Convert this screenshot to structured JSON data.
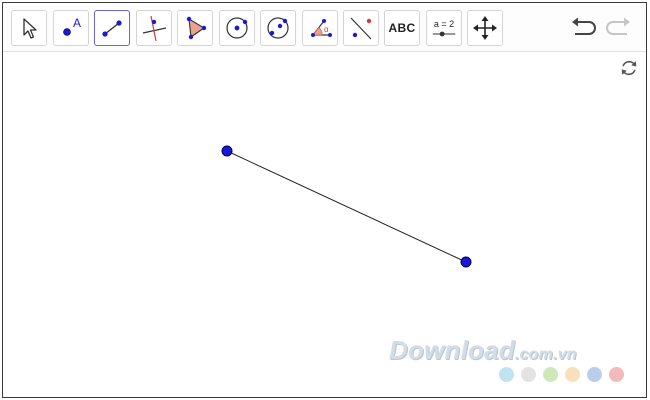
{
  "toolbar": {
    "tools": [
      {
        "name": "Move",
        "icon": "arrow-cursor-icon"
      },
      {
        "name": "Point",
        "icon": "point-icon",
        "label": "A"
      },
      {
        "name": "Segment",
        "icon": "segment-icon",
        "active": true
      },
      {
        "name": "Perpendicular Line",
        "icon": "perpendicular-line-icon"
      },
      {
        "name": "Polygon",
        "icon": "polygon-icon"
      },
      {
        "name": "Circle with Center through Point",
        "icon": "circle-center-point-icon"
      },
      {
        "name": "Circle through 3 Points",
        "icon": "circle-three-points-icon"
      },
      {
        "name": "Angle",
        "icon": "angle-icon",
        "label": "α"
      },
      {
        "name": "Reflect about Line",
        "icon": "reflect-line-icon"
      },
      {
        "name": "Text",
        "icon": "text-icon",
        "label": "ABC"
      },
      {
        "name": "Slider",
        "icon": "slider-icon",
        "label": "a = 2"
      },
      {
        "name": "Move Graphics View",
        "icon": "move-graphics-icon"
      }
    ],
    "undo_icon": "undo-icon",
    "redo_icon": "redo-icon"
  },
  "canvas": {
    "refresh_icon": "refresh-icon",
    "segment": {
      "color": "#222222"
    },
    "point_color": "#1a1ad6"
  },
  "watermark": {
    "text_main": "Download",
    "text_domain": ".com.vn",
    "dot_colors": [
      "#bfe3f1",
      "#e3e3e3",
      "#cde9b9",
      "#f9e0b9",
      "#b7cfe9",
      "#f4b9b9"
    ]
  },
  "colors": {
    "active_border": "#6a67c9",
    "accent_red": "#d63b3b",
    "polygon_fill": "#e9a28f",
    "point_blue": "#1a1ad6"
  }
}
